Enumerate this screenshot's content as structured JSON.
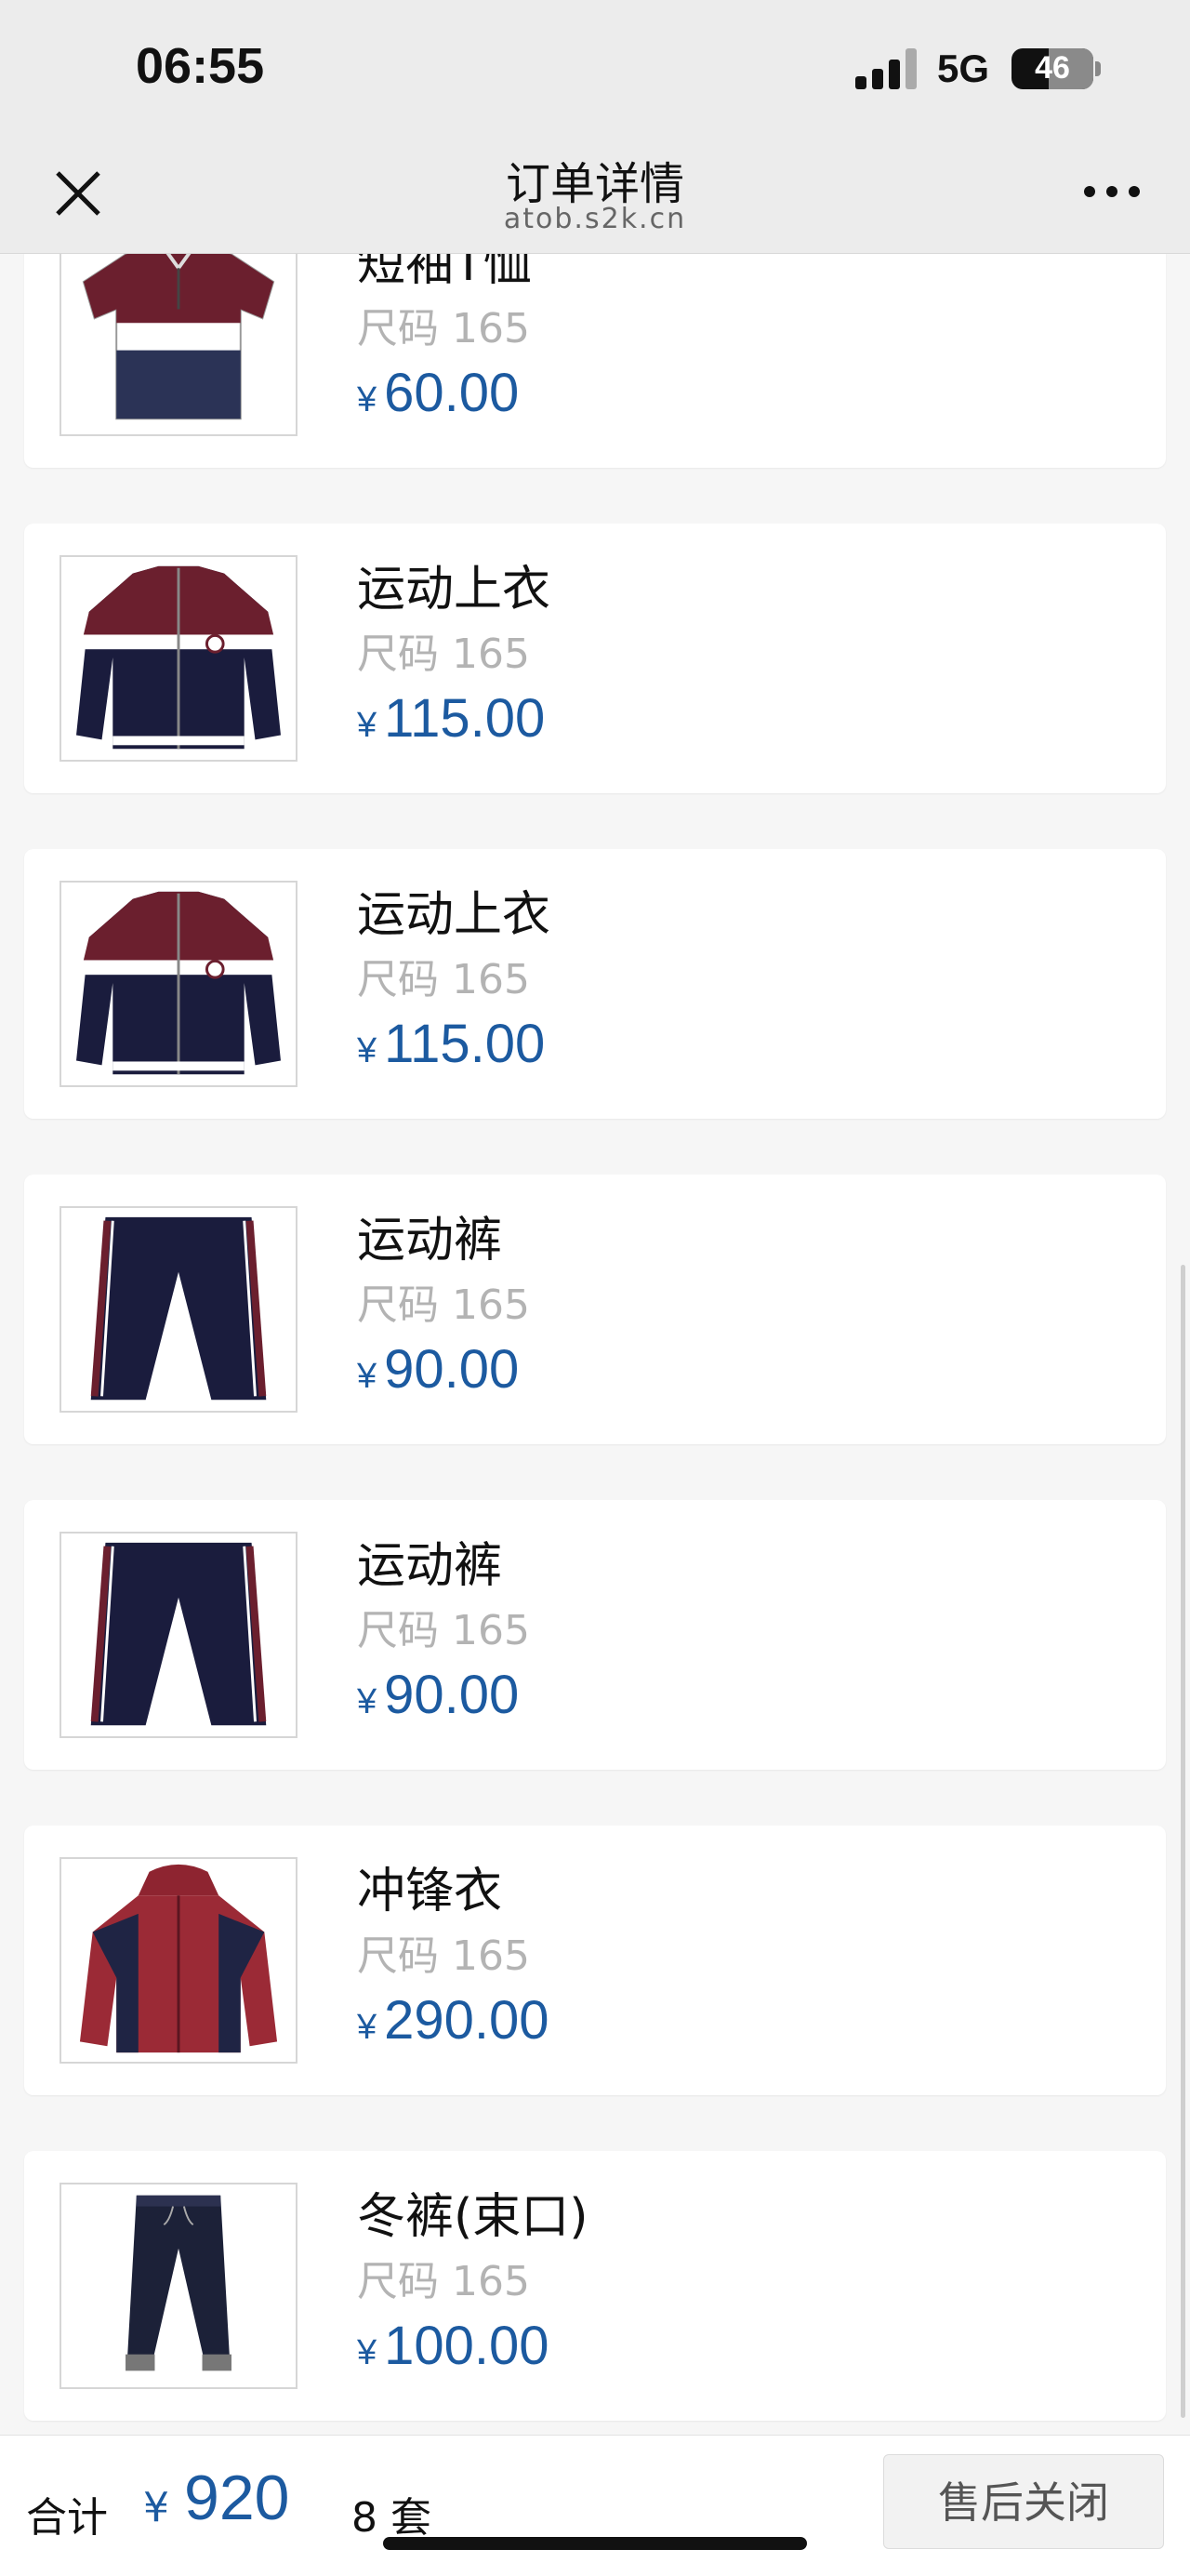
{
  "status_bar": {
    "time": "06:55",
    "network": "5G",
    "battery": "46",
    "battery_level": 0.46
  },
  "header": {
    "title": "订单详情",
    "subtitle": "atob.s2k.cn",
    "close_icon": "close-icon",
    "more_icon": "more-icon"
  },
  "items": [
    {
      "name": "短袖T恤",
      "size": "尺码 165",
      "currency": "¥",
      "price": "60.00",
      "icon": "polo-shirt"
    },
    {
      "name": "运动上衣",
      "size": "尺码 165",
      "currency": "¥",
      "price": "115.00",
      "icon": "track-jacket"
    },
    {
      "name": "运动上衣",
      "size": "尺码 165",
      "currency": "¥",
      "price": "115.00",
      "icon": "track-jacket"
    },
    {
      "name": "运动裤",
      "size": "尺码 165",
      "currency": "¥",
      "price": "90.00",
      "icon": "track-pants"
    },
    {
      "name": "运动裤",
      "size": "尺码 165",
      "currency": "¥",
      "price": "90.00",
      "icon": "track-pants"
    },
    {
      "name": "冲锋衣",
      "size": "尺码 165",
      "currency": "¥",
      "price": "290.00",
      "icon": "windbreaker"
    },
    {
      "name": "冬裤(束口)",
      "size": "尺码 165",
      "currency": "¥",
      "price": "100.00",
      "icon": "jogger-pants"
    }
  ],
  "footer": {
    "total_label": "合计",
    "currency": "¥",
    "total": "920",
    "quantity": "8 套",
    "after_sale_button": "售后关闭"
  },
  "colors": {
    "price_blue": "#1c5aa0",
    "maroon": "#6b1f2e",
    "navy": "#1a1c3d"
  }
}
